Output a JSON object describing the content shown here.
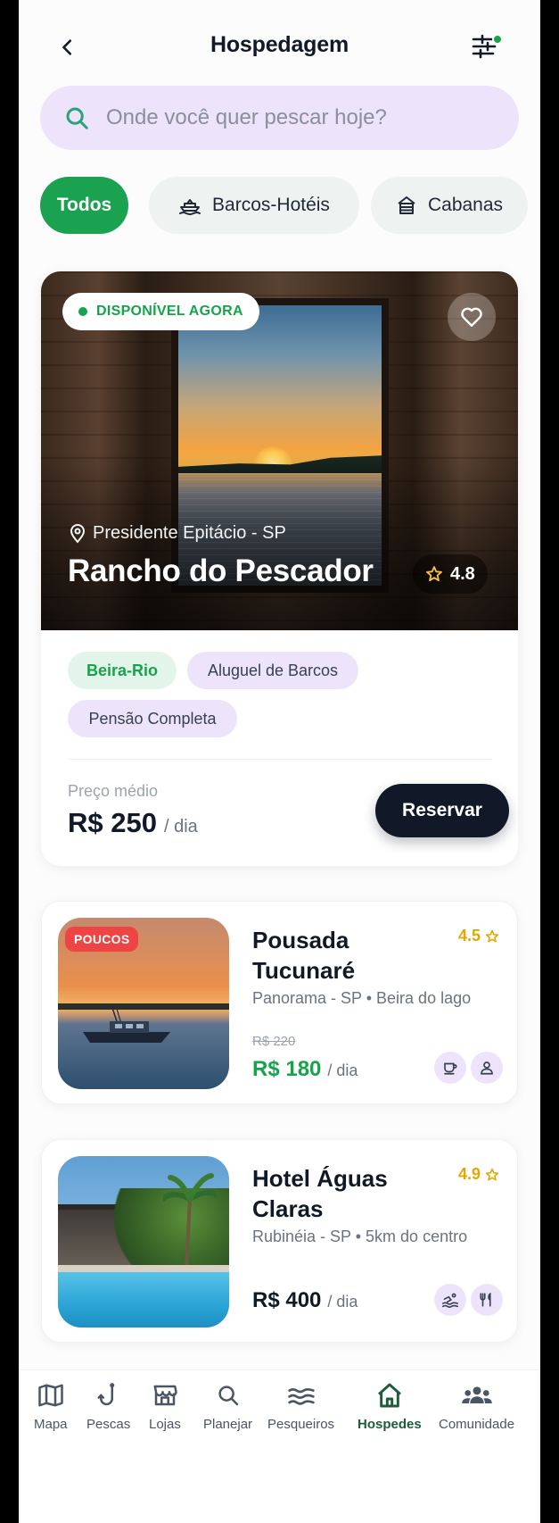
{
  "header": {
    "title": "Hospedagem"
  },
  "search": {
    "placeholder": "Onde você quer pescar hoje?"
  },
  "chips": [
    {
      "label": "Todos",
      "active": true
    },
    {
      "label": "Barcos-Hotéis",
      "icon": "boat-icon"
    },
    {
      "label": "Cabanas",
      "icon": "cabin-icon"
    }
  ],
  "featured": {
    "badge": "DISPONÍVEL AGORA",
    "location": "Presidente Epitácio - SP",
    "name": "Rancho do Pescador",
    "rating": "4.8",
    "tags": [
      "Beira-Rio",
      "Aluguel de Barcos",
      "Pensão Completa"
    ],
    "price_label": "Preço médio",
    "price": "R$ 250",
    "price_unit": "/ dia",
    "reserve_label": "Reservar"
  },
  "listings": [
    {
      "badge": "POUCOS",
      "name": "Pousada Tucunaré",
      "rating": "4.5",
      "location": "Panorama - SP • Beira do lago",
      "old_price": "R$ 220",
      "price": "R$ 180",
      "price_unit": "/ dia",
      "amenities": [
        "coffee-icon",
        "user-icon"
      ]
    },
    {
      "name": "Hotel Águas Claras",
      "rating": "4.9",
      "location": "Rubinéia - SP • 5km do centro",
      "price": "R$ 400",
      "price_unit": "/ dia",
      "amenities": [
        "pool-icon",
        "restaurant-icon"
      ]
    }
  ],
  "nav": [
    {
      "label": "Mapa",
      "icon": "map-icon"
    },
    {
      "label": "Pescas",
      "icon": "fishhook-icon"
    },
    {
      "label": "Lojas",
      "icon": "store-icon"
    },
    {
      "label": "Planejar",
      "icon": "search-icon"
    },
    {
      "label": "Pesqueiros",
      "icon": "waves-icon"
    },
    {
      "label": "Hospedes",
      "icon": "home-icon",
      "active": true
    },
    {
      "label": "Comunidade",
      "icon": "community-icon"
    }
  ],
  "colors": {
    "primary_green": "#1aa251",
    "lavender": "#ede4fb",
    "dark": "#111827",
    "gold": "#e0a800",
    "badge_red": "#ef4444"
  }
}
